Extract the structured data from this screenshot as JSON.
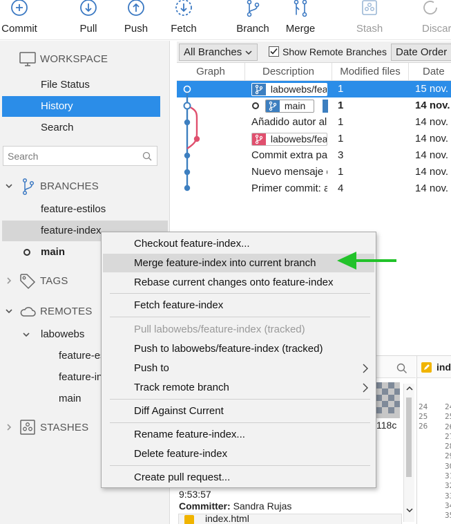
{
  "toolbar": {
    "commit": "Commit",
    "pull": "Pull",
    "push": "Push",
    "fetch": "Fetch",
    "branch": "Branch",
    "merge": "Merge",
    "stash": "Stash",
    "discard": "Discard"
  },
  "sidebar": {
    "workspace": {
      "title": "WORKSPACE",
      "items": [
        "File Status",
        "History",
        "Search"
      ]
    },
    "search_placeholder": "Search",
    "branches": {
      "title": "BRANCHES",
      "items": [
        "feature-estilos",
        "feature-index",
        "main"
      ]
    },
    "tags_title": "TAGS",
    "remotes": {
      "title": "REMOTES",
      "remote_name": "labowebs",
      "items": [
        "feature-estilos",
        "feature-index",
        "main"
      ]
    },
    "stashes_title": "STASHES"
  },
  "filterbar": {
    "branch_filter": "All Branches",
    "show_remote": "Show Remote Branches",
    "order": "Date Order"
  },
  "columns": {
    "graph": "Graph",
    "description": "Description",
    "modified": "Modified files",
    "date": "Date"
  },
  "commits": [
    {
      "tag": "labowebs/feature-index",
      "description": "",
      "modified": "1",
      "date": "15 nov."
    },
    {
      "tag": "main",
      "description": "",
      "modified": "1",
      "date": "14 nov."
    },
    {
      "tag": "",
      "description": "Añadido autor al footer",
      "modified": "1",
      "date": "14 nov."
    },
    {
      "tag": "labowebs/feature-estilos",
      "description": "",
      "modified": "1",
      "date": "14 nov."
    },
    {
      "tag": "",
      "description": "Commit extra para pruebas",
      "modified": "3",
      "date": "14 nov."
    },
    {
      "tag": "",
      "description": "Nuevo mensaje en index",
      "modified": "1",
      "date": "14 nov."
    },
    {
      "tag": "",
      "description": "Primer commit: archivos",
      "modified": "4",
      "date": "14 nov."
    }
  ],
  "details": {
    "hash_fragment": "118c",
    "time": "9:53:57",
    "committer_label": "Committer:",
    "committer_name": "Sandra Rujas",
    "file_tab": "index.html",
    "file_tab_short": "index"
  },
  "line_numbers": [
    "24",
    "25",
    "26"
  ],
  "line_numbers_right": [
    "24",
    "25",
    "26",
    "27",
    "28",
    "29",
    "30",
    "31",
    "32",
    "33",
    "34",
    "35"
  ],
  "context_menu": {
    "items": [
      "Checkout feature-index...",
      "Merge feature-index into current branch",
      "Rebase current changes onto feature-index",
      "Fetch feature-index",
      "Pull labowebs/feature-index (tracked)",
      "Push to labowebs/feature-index (tracked)",
      "Push to",
      "Track remote branch",
      "Diff Against Current",
      "Rename feature-index...",
      "Delete feature-index",
      "Create pull request..."
    ]
  },
  "colors": {
    "selection": "#2b8de8",
    "graph_blue": "#3d7fc0",
    "graph_pink": "#e0506e",
    "arrow": "#22c22a"
  }
}
